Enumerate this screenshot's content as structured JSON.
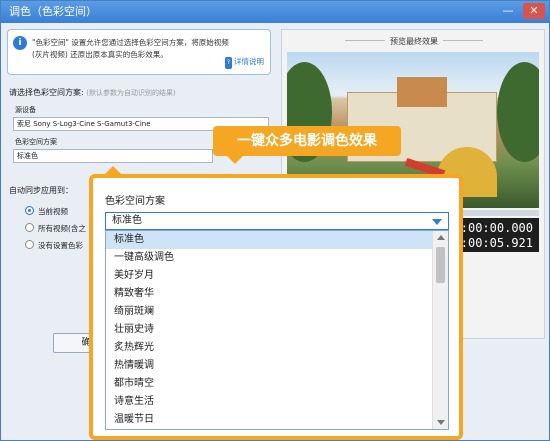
{
  "window": {
    "title": "调色（色彩空间）",
    "min_icon": "minimize-icon",
    "close_icon": "close-icon"
  },
  "info": {
    "text_line1": "\"色彩空间\" 设置允许您通过选择色彩空间方案，将原始视频",
    "text_line2": "(灰片视频) 还原出原本真实的色彩效果。",
    "help_label": "详情说明",
    "help_icon_text": "?"
  },
  "colorspace": {
    "section_label": "请选择色彩空间方案:",
    "section_hint": "(默认参数为自动识别的结果)",
    "source_device_label": "源设备",
    "source_device_value": "索尼 Sony S-Log3-Cine S-Gamut3-Cine",
    "scheme_label": "色彩空间方案",
    "scheme_value": "标准色"
  },
  "apply": {
    "label": "自动同步应用到：",
    "options": [
      "当前视频",
      "所有视频(含之",
      "没有设置色彩"
    ],
    "selected_index": 0
  },
  "buttons": {
    "ok": "确"
  },
  "preview": {
    "title": "预览最终效果",
    "time_current": "00:00:00.000",
    "time_total": "00:00:05.921",
    "progress": 0
  },
  "callout": {
    "text": "一键众多电影调色效果"
  },
  "popup": {
    "label": "色彩空间方案",
    "selected": "标准色",
    "items": [
      "标准色",
      "一键高级调色",
      "美好岁月",
      "精致奢华",
      "绮丽斑斓",
      "壮丽史诗",
      "炙热辉光",
      "热情暖调",
      "都市晴空",
      "诗意生活",
      "温暖节日"
    ],
    "selected_index": 0
  },
  "colors": {
    "accent": "#2f7bd6",
    "callout": "#f5a623",
    "titlebar": "#3a7fd4"
  }
}
